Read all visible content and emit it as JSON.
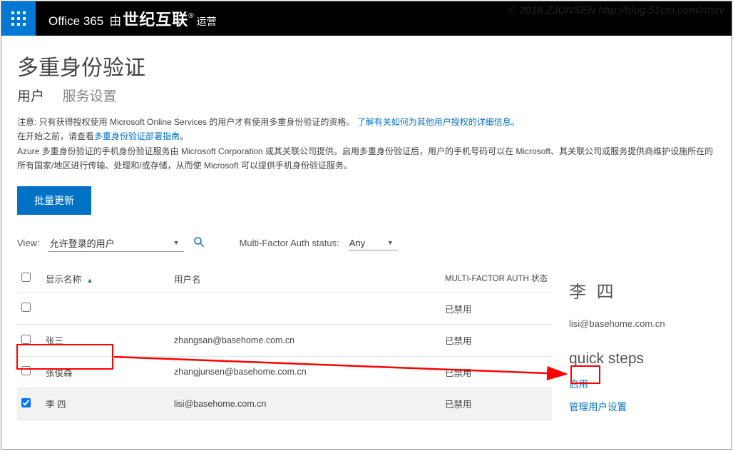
{
  "watermark": "© 2018 ZJUNSEN http://blog.51cto.com/rdsrv",
  "header": {
    "o365": "Office 365",
    "by": "由",
    "vianet": "世纪互联",
    "op": "运营"
  },
  "page": {
    "title": "多重身份验证",
    "tab_users": "用户",
    "tab_settings": "服务设置",
    "notice1a": "注意: 只有获得授权使用 Microsoft Online Services 的用户才有使用多重身份验证的资格。",
    "notice1_link": "了解有关如何为其他用户授权的详细信息。",
    "notice2a": "在开始之前，请查看",
    "notice2_link": "多重身份验证部署指南",
    "notice2b": "。",
    "notice3": "Azure 多重身份验证的手机身份验证服务由 Microsoft Corporation 或其关联公司提供。启用多重身份验证后，用户的手机号码可以在 Microsoft、其关联公司或服务提供商维护设施所在的所有国家/地区进行传输、处理和/或存储，从而使 Microsoft 可以提供手机身份验证服务。",
    "btn_bulk": "批量更新"
  },
  "filters": {
    "view_label": "View:",
    "view_value": "允许登录的用户",
    "mfa_label": "Multi-Factor Auth status:",
    "mfa_value": "Any"
  },
  "table": {
    "col_displayname": "显示名称",
    "col_username": "用户名",
    "col_mfa": "MULTI-FACTOR AUTH 状态",
    "rows": [
      {
        "dn": "",
        "un": "",
        "status": "已禁用",
        "checked": false
      },
      {
        "dn": "张三",
        "un": "zhangsan@basehome.com.cn",
        "status": "已禁用",
        "checked": false
      },
      {
        "dn": "张俊森",
        "un": "zhangjunsen@basehome.com.cn",
        "status": "已禁用",
        "checked": false
      },
      {
        "dn": "李 四",
        "un": "lisi@basehome.com.cn",
        "status": "已禁用",
        "checked": true
      }
    ]
  },
  "side": {
    "name": "李 四",
    "email": "lisi@basehome.com.cn",
    "quick_steps": "quick steps",
    "enable": "启用",
    "manage": "管理用户设置"
  }
}
